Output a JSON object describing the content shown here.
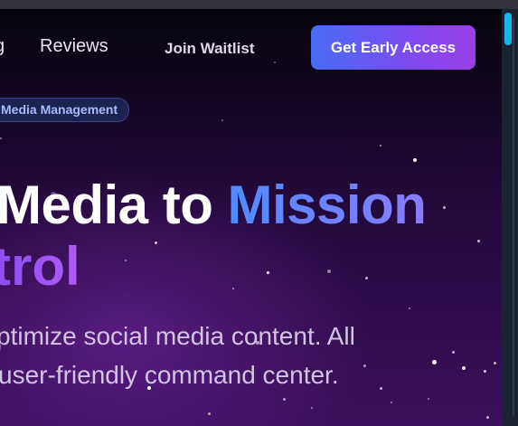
{
  "nav": {
    "prev_label": "g",
    "reviews_label": "Reviews",
    "join_label": "Join Waitlist",
    "cta_label": "Get Early Access"
  },
  "hero": {
    "badge_label": "Media Management",
    "headline_part1": "Media to ",
    "headline_part2": "Mission",
    "headline_line2": "trol",
    "description_line1": "ptimize social media content. All",
    "description_line2": "user-friendly command center."
  },
  "colors": {
    "cta_gradient_start": "#4a6cf7",
    "cta_gradient_end": "#9a3fe6",
    "accent_blue": "#4f8bff",
    "accent_purple": "#a055f3",
    "scroll_thumb": "#18b5f0"
  }
}
